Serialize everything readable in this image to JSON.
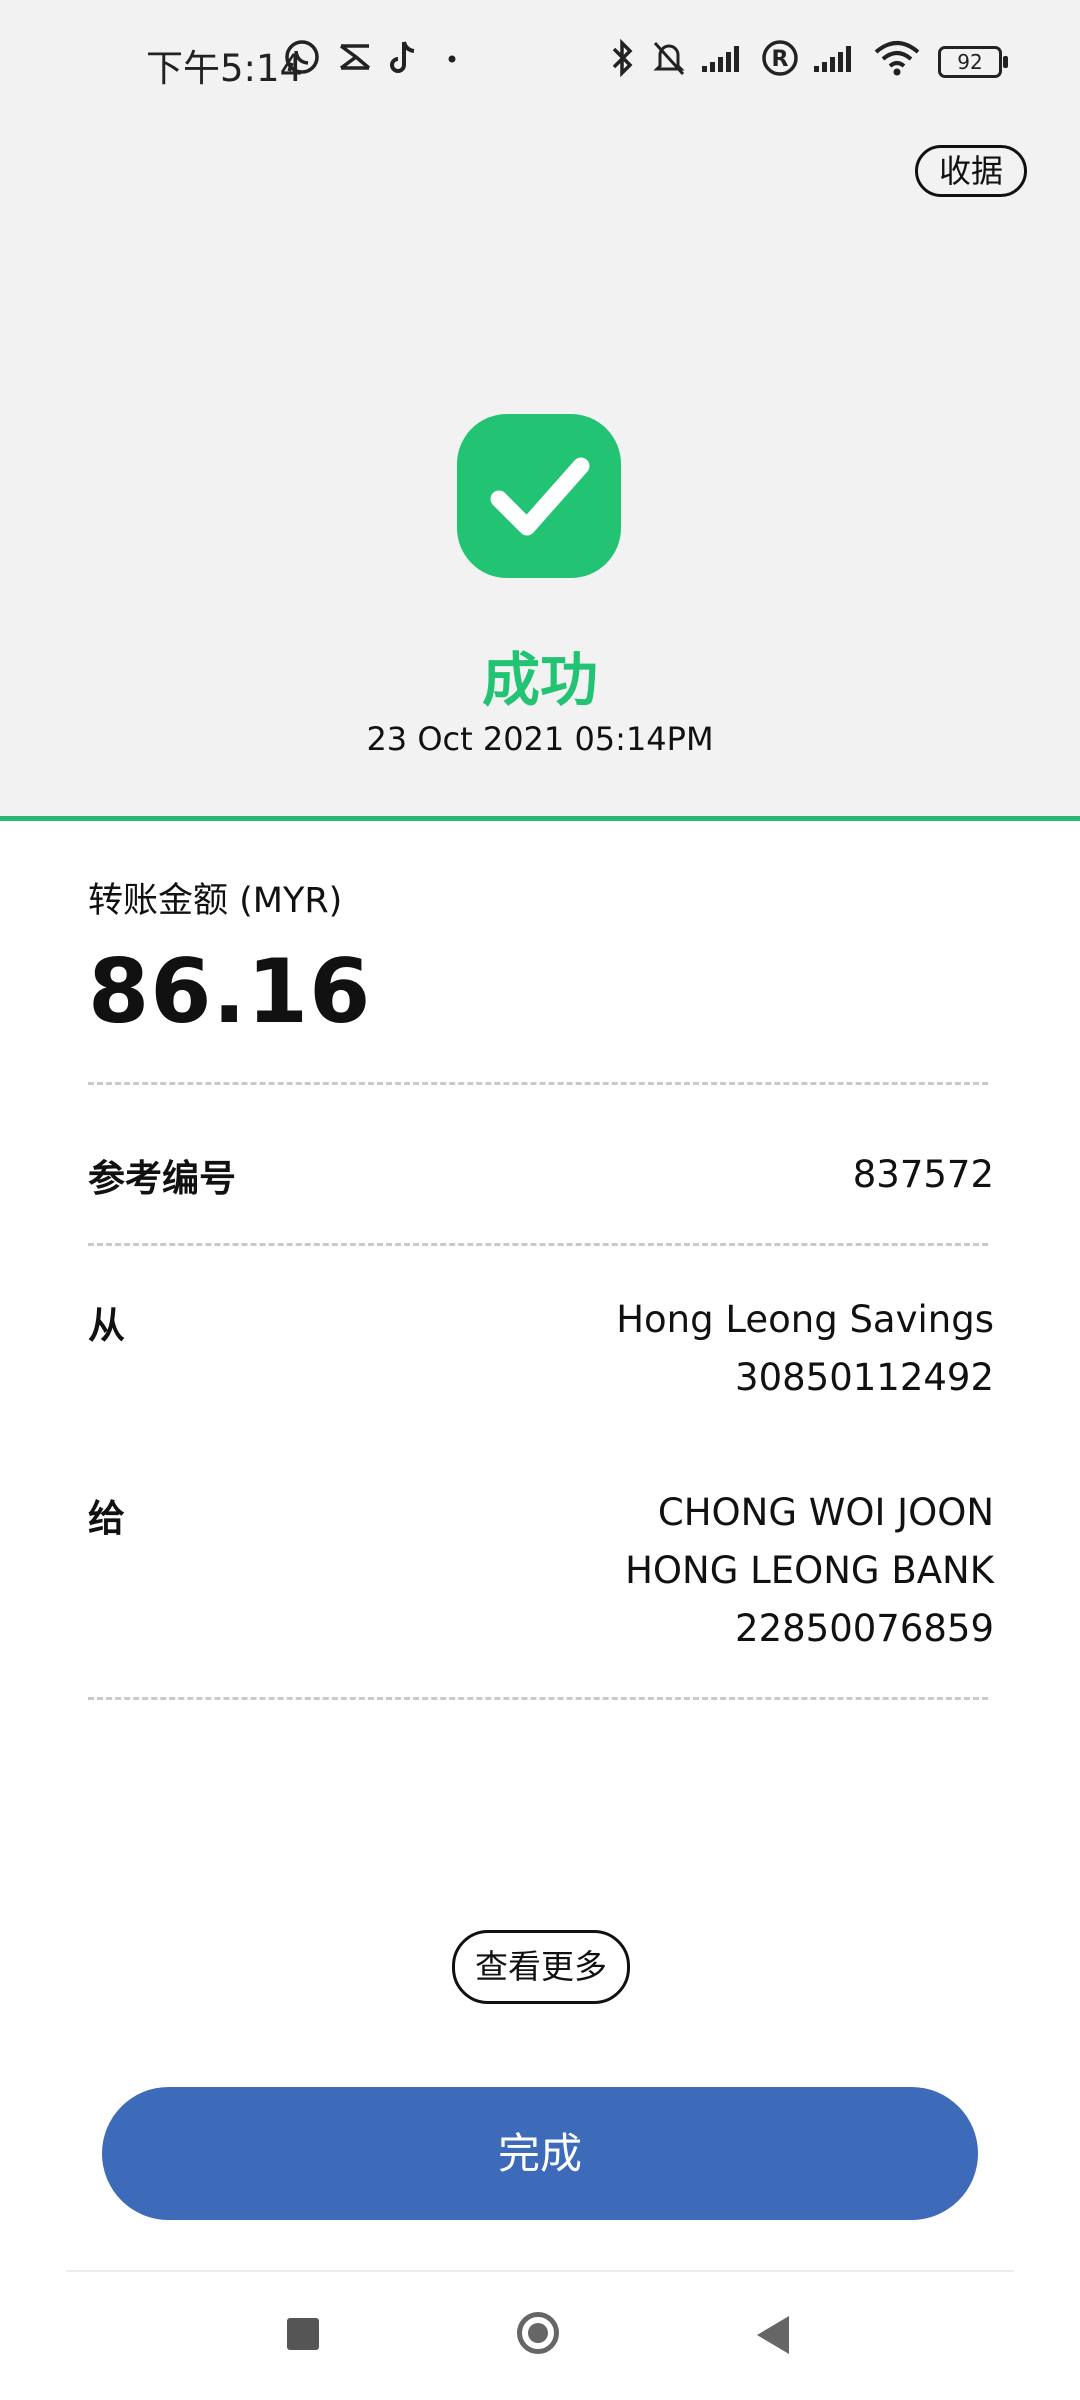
{
  "status_bar": {
    "time": "下午5:14",
    "battery": "92",
    "icons": [
      "whatsapp-icon",
      "app-icon",
      "tiktok-icon",
      "dot-icon",
      "bluetooth-icon",
      "mute-icon",
      "signal-icon",
      "registered-icon",
      "signal-icon",
      "wifi-icon",
      "battery-icon"
    ]
  },
  "header": {
    "receipt_label": "收据"
  },
  "result": {
    "status": "成功",
    "datetime": "23 Oct 2021 05:14PM"
  },
  "details": {
    "amount_label": "转账金额 (MYR)",
    "amount": "86.16",
    "reference_label": "参考编号",
    "reference_value": "837572",
    "from_label": "从",
    "from_line1": "Hong Leong Savings",
    "from_line2": "30850112492",
    "to_label": "给",
    "to_line1": "CHONG WOI JOON",
    "to_line2": "HONG LEONG BANK",
    "to_line3": "22850076859"
  },
  "actions": {
    "more_label": "查看更多",
    "done_label": "完成"
  },
  "colors": {
    "success": "#22c372",
    "primary": "#3d6bb9",
    "top_bg": "#f2f2f2"
  }
}
